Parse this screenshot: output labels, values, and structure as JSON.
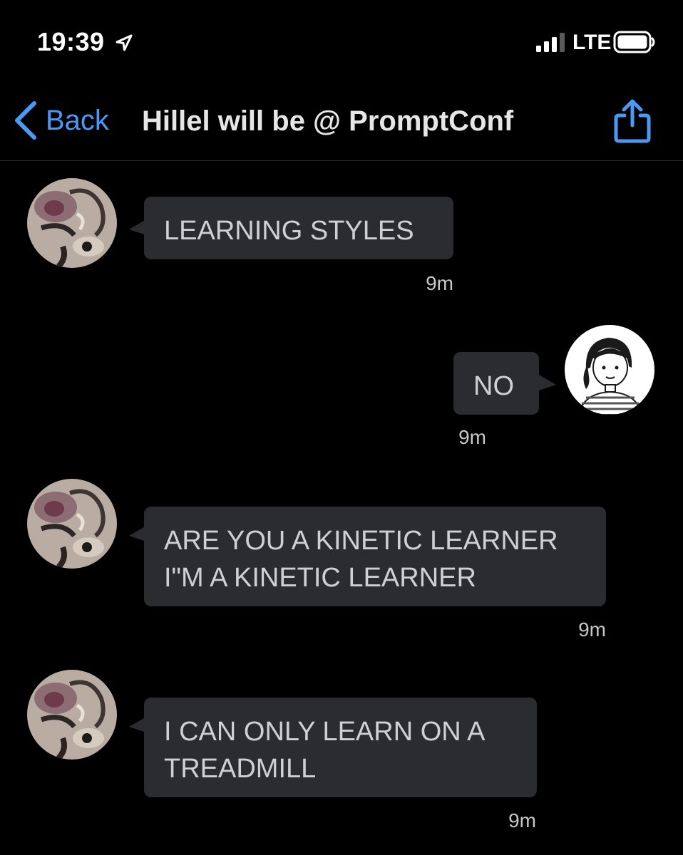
{
  "status_bar": {
    "time": "19:39",
    "network": "LTE",
    "icons": [
      "location-arrow-icon",
      "signal-bars-icon",
      "battery-icon"
    ]
  },
  "nav": {
    "back_label": "Back",
    "title": "Hillel will be @ PromptConf",
    "back_icon": "chevron-left-icon",
    "share_icon": "share-icon"
  },
  "colors": {
    "accent": "#4a9af5",
    "bubble": "#2b2c2f",
    "bubble_text": "#cfd0d2",
    "background": "#000000"
  },
  "messages": [
    {
      "sender": "other",
      "lines": [
        "LEARNING STYLES"
      ],
      "time": "9m"
    },
    {
      "sender": "me",
      "lines": [
        "NO"
      ],
      "time": "9m"
    },
    {
      "sender": "other",
      "lines": [
        "ARE YOU A KINETIC LEARNER",
        "I\"M A KINETIC LEARNER"
      ],
      "time": "9m"
    },
    {
      "sender": "other",
      "lines": [
        "I CAN ONLY LEARN ON A",
        "TREADMILL"
      ],
      "time": "9m"
    }
  ]
}
